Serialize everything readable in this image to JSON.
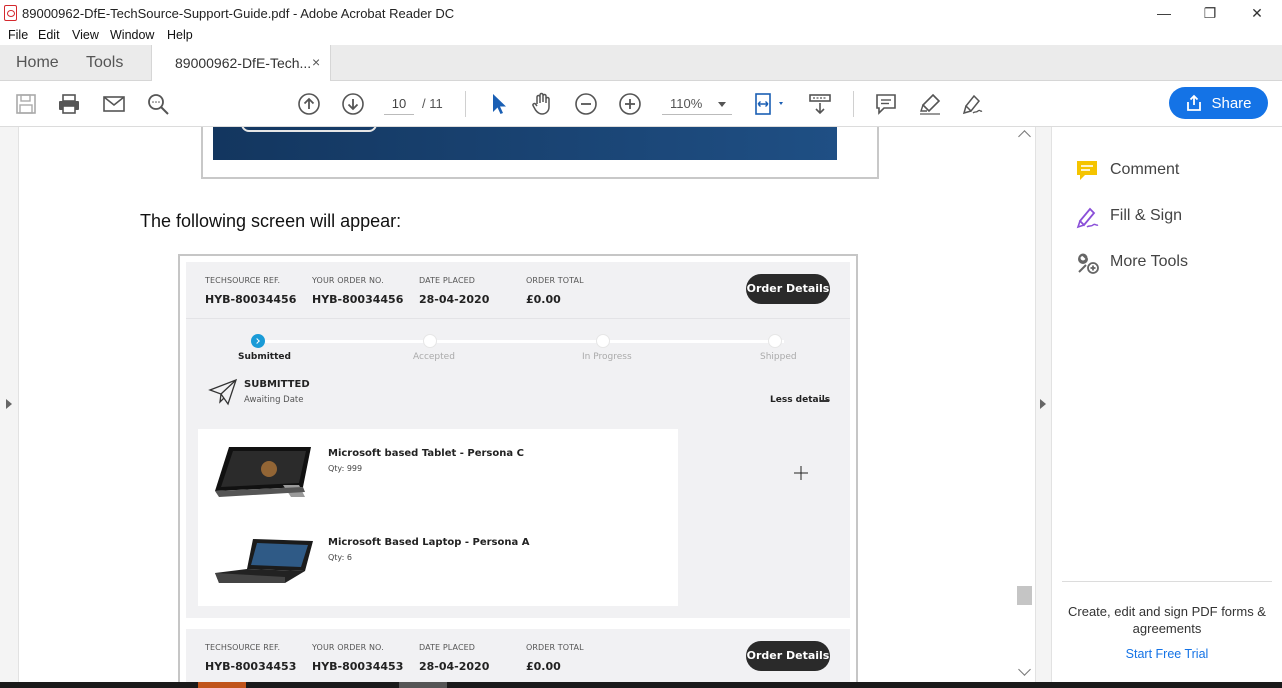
{
  "window": {
    "title": "89000962-DfE-TechSource-Support-Guide.pdf - Adobe Acrobat Reader DC",
    "minimize": "—",
    "restore": "❐",
    "close": "✕"
  },
  "menu": [
    "File",
    "Edit",
    "View",
    "Window",
    "Help"
  ],
  "tabs": {
    "home": "Home",
    "tools": "Tools",
    "document": "89000962-DfE-Tech...",
    "document_close": "×"
  },
  "toolbar": {
    "page_current": "10",
    "page_total": "/ 11",
    "zoom": "110%",
    "share_label": "Share"
  },
  "document": {
    "text": "The following screen will appear:",
    "orders": [
      {
        "ref_label": "TECHSOURCE REF.",
        "ref": "HYB-80034456",
        "order_label": "YOUR ORDER NO.",
        "order": "HYB-80034456",
        "date_label": "DATE PLACED",
        "date": "28-04-2020",
        "total_label": "ORDER TOTAL",
        "total": "£0.00",
        "button": "Order Details"
      },
      {
        "ref_label": "TECHSOURCE REF.",
        "ref": "HYB-80034453",
        "order_label": "YOUR ORDER NO.",
        "order": "HYB-80034453",
        "date_label": "DATE PLACED",
        "date": "28-04-2020",
        "total_label": "ORDER TOTAL",
        "total": "£0.00",
        "button": "Order Details"
      }
    ],
    "steps": [
      "Submitted",
      "Accepted",
      "In Progress",
      "Shipped"
    ],
    "active_step": "Submitted",
    "status_title": "SUBMITTED",
    "status_sub": "Awaiting Date",
    "less_details": "Less details",
    "items": [
      {
        "name": "Microsoft based Tablet - Persona C",
        "qty": "Qty: 999"
      },
      {
        "name": "Microsoft Based Laptop - Persona A",
        "qty": "Qty: 6"
      }
    ]
  },
  "right_panel": {
    "tools": [
      "Comment",
      "Fill & Sign",
      "More Tools"
    ],
    "promo": "Create, edit and sign PDF forms & agreements",
    "trial": "Start Free Trial"
  },
  "colors": {
    "accent": "#1473e6",
    "banner": "#1b4676",
    "step_active": "#1a9bd7",
    "comment_icon": "#f5c400",
    "fill_sign_icon": "#8a4fd8"
  }
}
